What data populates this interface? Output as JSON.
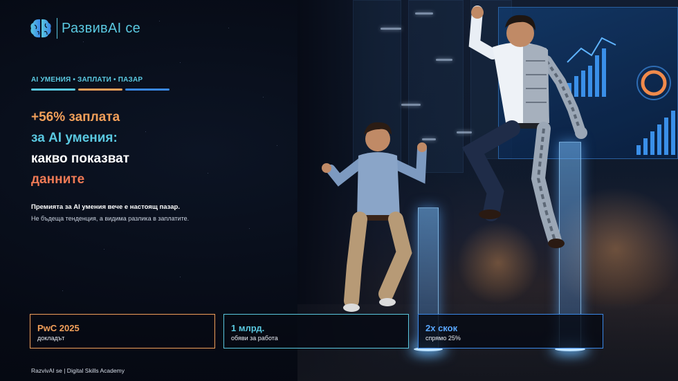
{
  "brand": {
    "name": "РазвивAI се",
    "icon": "brain-icon"
  },
  "tagline": "AI УМЕНИЯ • ЗАПЛАТИ • ПАЗАР",
  "stripe_colors": [
    "#5ac8e0",
    "#f3a05a",
    "#3a88e8"
  ],
  "headline": {
    "line1": "+56% заплата",
    "line2": "за AI умения:",
    "line3": "какво показват",
    "line4": "данните"
  },
  "lead": "Премията за AI умения вече е настоящ пазар.",
  "subtext": "Не бъдеща тенденция, а видима разлика в заплатите.",
  "cards": [
    {
      "title": "PwC 2025",
      "subtitle": "докладът",
      "color": "#f3a05a"
    },
    {
      "title": "1 млрд.",
      "subtitle": "обяви за работа",
      "color": "#5ac8e0"
    },
    {
      "title": "2x скок",
      "subtitle": "спрямо 25%",
      "color": "#3a88e8"
    }
  ],
  "footer": "RazvivAI se | Digital Skills Academy"
}
